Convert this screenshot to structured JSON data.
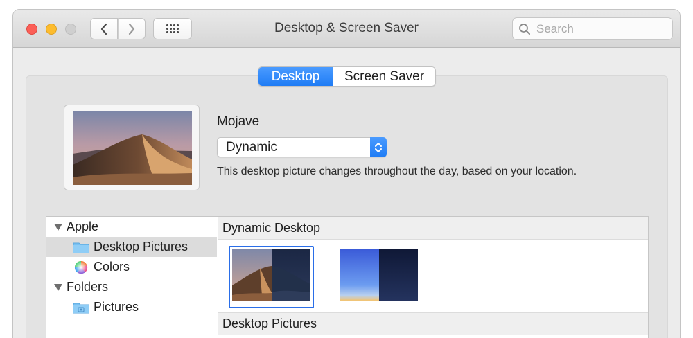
{
  "window": {
    "title": "Desktop & Screen Saver"
  },
  "search": {
    "placeholder": "Search"
  },
  "tabs": [
    {
      "label": "Desktop",
      "active": true
    },
    {
      "label": "Screen Saver",
      "active": false
    }
  ],
  "wallpaper": {
    "name": "Mojave",
    "mode_value": "Dynamic",
    "description": "This desktop picture changes throughout the day, based on your location."
  },
  "sidebar": {
    "items": [
      {
        "label": "Apple",
        "type": "group",
        "icon": "disclosure-triangle"
      },
      {
        "label": "Desktop Pictures",
        "type": "folder",
        "icon": "folder-icon",
        "selected": true
      },
      {
        "label": "Colors",
        "type": "colors",
        "icon": "color-wheel-icon"
      },
      {
        "label": "Folders",
        "type": "group",
        "icon": "disclosure-triangle"
      },
      {
        "label": "Pictures",
        "type": "folder",
        "icon": "pictures-folder-icon"
      }
    ]
  },
  "gallery": {
    "sections": [
      {
        "title": "Dynamic Desktop"
      },
      {
        "title": "Desktop Pictures"
      }
    ]
  },
  "colors": {
    "accent": "#1f7cf5",
    "selection_border": "#2a6ee8",
    "close": "#fc5f57",
    "minimize": "#fdbc2e"
  }
}
